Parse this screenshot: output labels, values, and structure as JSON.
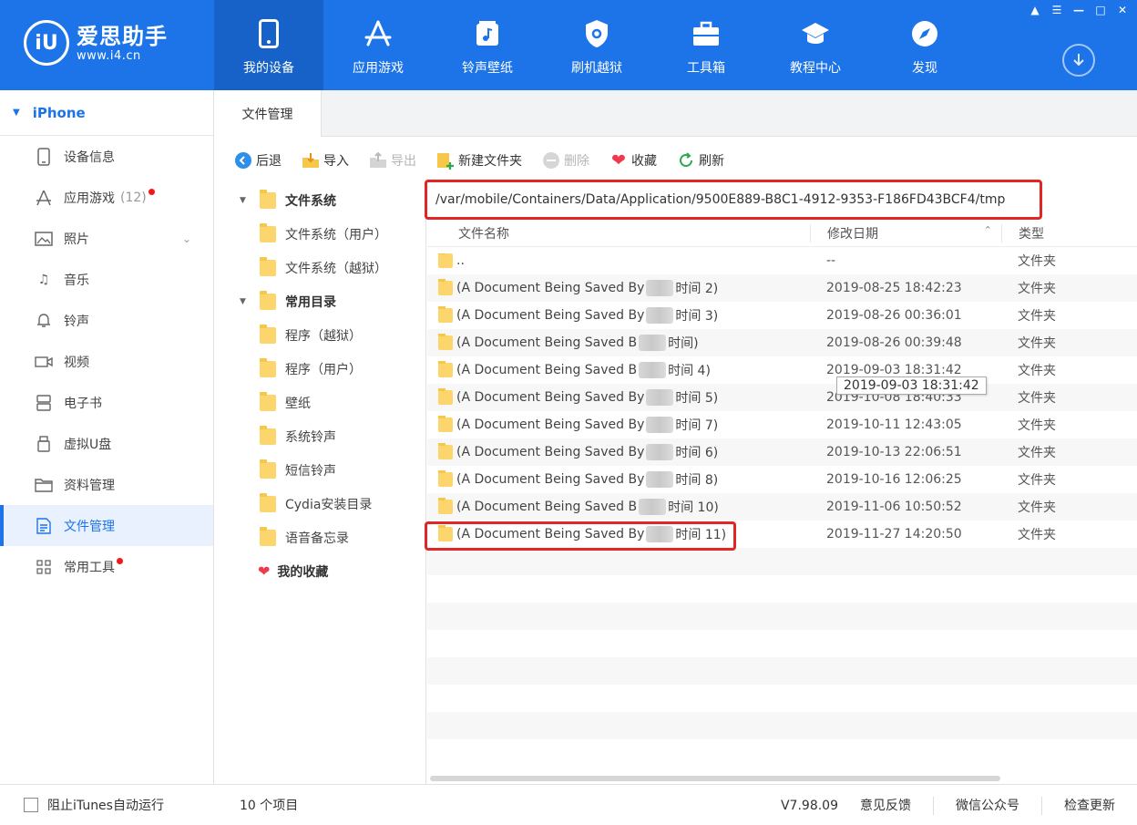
{
  "app": {
    "logo_badge": "iU",
    "logo_name": "爱思助手",
    "logo_url": "www.i4.cn"
  },
  "nav": [
    {
      "label": "我的设备",
      "icon": "phone-icon"
    },
    {
      "label": "应用游戏",
      "icon": "app-store-icon"
    },
    {
      "label": "铃声壁纸",
      "icon": "music-file-icon"
    },
    {
      "label": "刷机越狱",
      "icon": "shield-icon"
    },
    {
      "label": "工具箱",
      "icon": "toolbox-icon"
    },
    {
      "label": "教程中心",
      "icon": "graduation-cap-icon"
    },
    {
      "label": "发现",
      "icon": "compass-icon"
    }
  ],
  "sidebar": {
    "device": "iPhone",
    "items": [
      {
        "label": "设备信息",
        "icon": "device-info-icon"
      },
      {
        "label": "应用游戏",
        "count": "(12)",
        "icon": "app-icon"
      },
      {
        "label": "照片",
        "icon": "photo-icon"
      },
      {
        "label": "音乐",
        "icon": "music-icon"
      },
      {
        "label": "铃声",
        "icon": "bell-icon"
      },
      {
        "label": "视频",
        "icon": "video-icon"
      },
      {
        "label": "电子书",
        "icon": "book-icon"
      },
      {
        "label": "虚拟U盘",
        "icon": "usb-drive-icon"
      },
      {
        "label": "资料管理",
        "icon": "folder-icon"
      },
      {
        "label": "文件管理",
        "icon": "file-icon"
      },
      {
        "label": "常用工具",
        "icon": "grid-icon"
      }
    ]
  },
  "tabs": {
    "active": "文件管理"
  },
  "toolbar": {
    "back": "后退",
    "import": "导入",
    "export": "导出",
    "new_folder": "新建文件夹",
    "delete": "删除",
    "favorite": "收藏",
    "refresh": "刷新"
  },
  "tree": {
    "filesystem": "文件系统",
    "fs_user": "文件系统（用户）",
    "fs_jailbreak": "文件系统（越狱）",
    "common": "常用目录",
    "common_items": [
      "程序（越狱）",
      "程序（用户）",
      "壁纸",
      "系统铃声",
      "短信铃声",
      "Cydia安装目录",
      "语音备忘录"
    ],
    "favorites": "我的收藏"
  },
  "path": "/var/mobile/Containers/Data/Application/9500E889-B8C1-4912-9353-F186FD43BCF4/tmp",
  "list": {
    "headers": {
      "name": "文件名称",
      "date": "修改日期",
      "type": "类型"
    },
    "rows": [
      {
        "name_a": "..",
        "name_b": "",
        "date": "--",
        "type": "文件夹"
      },
      {
        "name_a": "(A Document Being Saved By",
        "name_b": "时间 2)",
        "date": "2019-08-25 18:42:23",
        "type": "文件夹"
      },
      {
        "name_a": "(A Document Being Saved By",
        "name_b": "时间 3)",
        "date": "2019-08-26 00:36:01",
        "type": "文件夹"
      },
      {
        "name_a": "(A Document Being Saved B",
        "name_b": "时间)",
        "date": "2019-08-26 00:39:48",
        "type": "文件夹"
      },
      {
        "name_a": "(A Document Being Saved B",
        "name_b": "时间 4)",
        "date": "2019-09-03 18:31:42",
        "type": "文件夹"
      },
      {
        "name_a": "(A Document Being Saved By",
        "name_b": "时间 5)",
        "date": "2019-10-08 18:40:33",
        "type": "文件夹"
      },
      {
        "name_a": "(A Document Being Saved By",
        "name_b": "时间 7)",
        "date": "2019-10-11 12:43:05",
        "type": "文件夹"
      },
      {
        "name_a": "(A Document Being Saved By",
        "name_b": "时间 6)",
        "date": "2019-10-13 22:06:51",
        "type": "文件夹"
      },
      {
        "name_a": "(A Document Being Saved By",
        "name_b": "时间 8)",
        "date": "2019-10-16 12:06:25",
        "type": "文件夹"
      },
      {
        "name_a": "(A Document Being Saved B",
        "name_b": "时间 10)",
        "date": "2019-11-06 10:50:52",
        "type": "文件夹"
      },
      {
        "name_a": "(A Document Being Saved By",
        "name_b": "时间 11)",
        "date": "2019-11-27 14:20:50",
        "type": "文件夹"
      }
    ],
    "tooltip": "2019-09-03 18:31:42"
  },
  "status": {
    "itunes_checkbox": "阻止iTunes自动运行",
    "item_count": "10 个项目",
    "version": "V7.98.09",
    "feedback": "意见反馈",
    "wechat": "微信公众号",
    "check_update": "检查更新"
  },
  "colors": {
    "brand_blue": "#1c74e8",
    "highlight_red": "#e22525",
    "notification_red": "#f01818",
    "folder_yellow": "#fcd66d"
  }
}
